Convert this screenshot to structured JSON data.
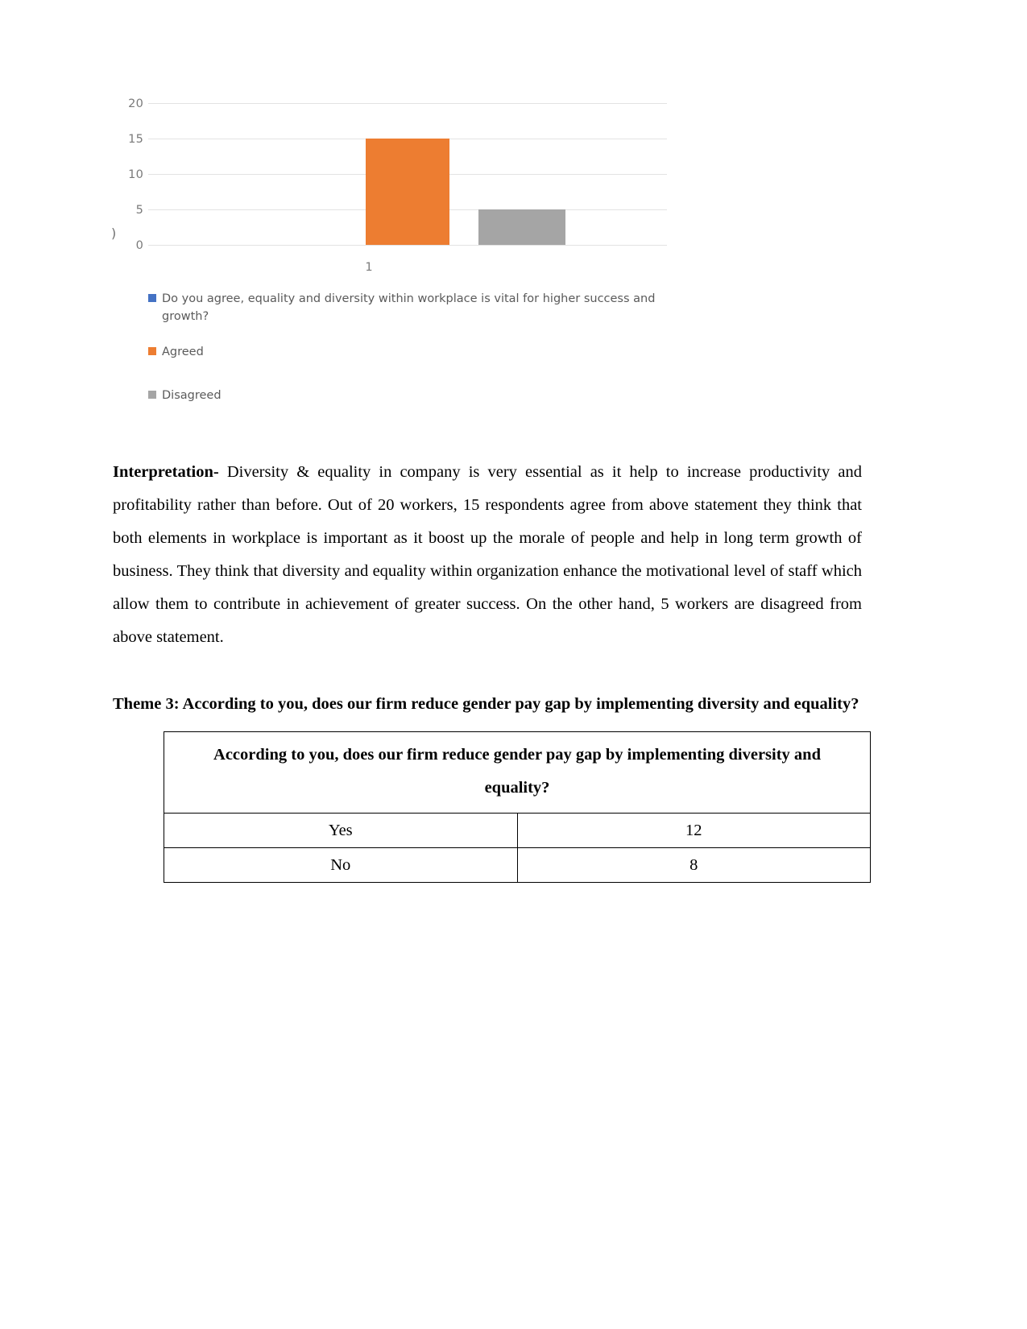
{
  "chart_data": {
    "type": "bar",
    "title": "",
    "subtitle": "",
    "xlabel": "",
    "ylabel": "",
    "categories": [
      "1"
    ],
    "x_tick_labels": [
      "1"
    ],
    "y_tick_labels": [
      "20",
      "15",
      "10",
      "5",
      "0"
    ],
    "ylim": [
      0,
      20
    ],
    "y_ticks": [
      0,
      5,
      10,
      15,
      20
    ],
    "grid": true,
    "legend_position": "bottom-left",
    "stray_glyph": ")",
    "series": [
      {
        "name": "Do you agree, equality and diversity within workplace is vital for higher success and growth?",
        "color": "#4472C4",
        "values": [
          null
        ]
      },
      {
        "name": "Agreed",
        "color": "#ED7D31",
        "values": [
          15
        ]
      },
      {
        "name": "Disagreed",
        "color": "#A5A5A5",
        "values": [
          5
        ]
      }
    ]
  },
  "chart": {
    "legend": [
      {
        "label": "Do you agree, equality and diversity within workplace is vital for higher success and growth?",
        "color": "#4472C4"
      },
      {
        "label": "Agreed",
        "color": "#ED7D31"
      },
      {
        "label": "Disagreed",
        "color": "#A5A5A5"
      }
    ]
  },
  "body": {
    "interpretation_label": "Interpretation-",
    "interpretation_text": " Diversity & equality in company is very essential as it help to increase productivity and profitability rather than before. Out of 20 workers, 15 respondents agree from above statement they think that both elements in workplace is important as it boost up the morale of people and help in long term growth of business. They think that diversity and equality within organization enhance the motivational level of staff which allow them to contribute in achievement of greater success. On the other hand, 5 workers are disagreed from above statement.",
    "theme_heading": "Theme 3: According to you, does our firm reduce gender pay gap by implementing diversity and equality?"
  },
  "table": {
    "header": "According to you, does our firm reduce gender pay gap by implementing diversity and equality?",
    "rows": [
      {
        "label": "Yes",
        "value": "12"
      },
      {
        "label": "No",
        "value": "8"
      }
    ]
  }
}
